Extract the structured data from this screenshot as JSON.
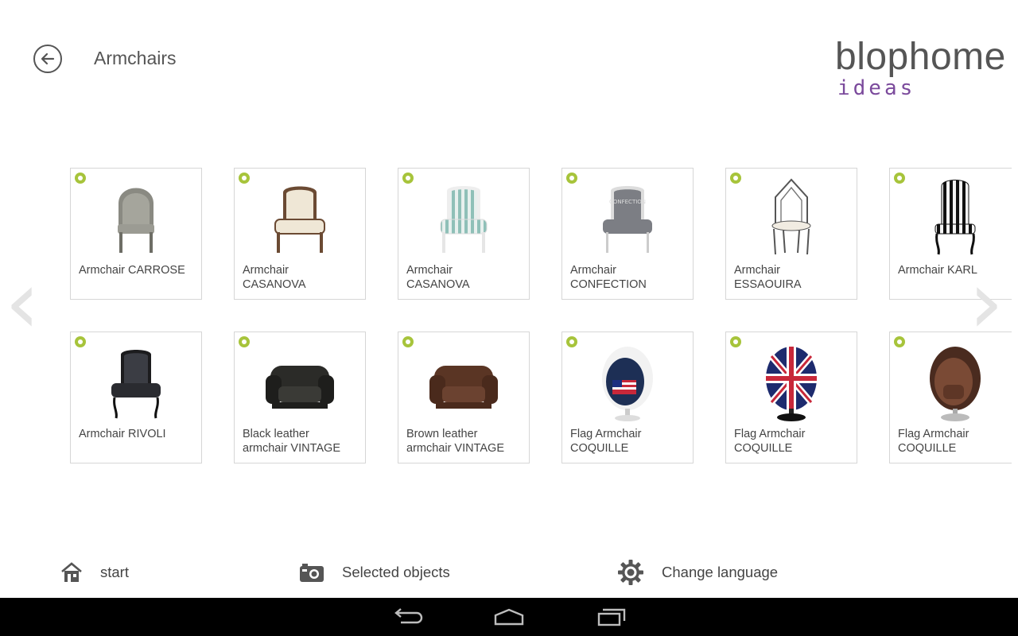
{
  "header": {
    "back_label": "Back",
    "title": "Armchairs"
  },
  "logo": {
    "main": "blophome",
    "sub": "ideas",
    "sub_color": "#7b4a9c"
  },
  "accent_color": "#a7c43b",
  "products": [
    {
      "name": "Armchair CARROSE",
      "kind": "canopy",
      "image": "grey hooded canopy armchair"
    },
    {
      "name": "Armchair\nCASANOVA",
      "kind": "bergere-cream",
      "image": "cream upholstered wooden bergere"
    },
    {
      "name": "Armchair\nCASANOVA",
      "kind": "striped",
      "image": "blue-green striped white armchair"
    },
    {
      "name": "Armchair\nCONFECTION",
      "kind": "grey-print",
      "image": "grey armchair with printed back"
    },
    {
      "name": "Armchair\nESSAOUIRA",
      "kind": "wire",
      "image": "wrought iron armchair with cushion"
    },
    {
      "name": "Armchair KARL",
      "kind": "stripe-highback",
      "image": "black and white striped high-back chair"
    },
    {
      "name": "Armchair RIVOLI",
      "kind": "black-bergere",
      "image": "black patchwork armchair"
    },
    {
      "name": "Black leather\narmchair VINTAGE",
      "kind": "chesterfield-black",
      "image": "black leather chesterfield armchair"
    },
    {
      "name": "Brown leather\narmchair VINTAGE",
      "kind": "chesterfield-brown",
      "image": "brown leather chesterfield armchair"
    },
    {
      "name": "Flag Armchair\nCOQUILLE",
      "kind": "egg-usa",
      "image": "egg chair with US flag cushion"
    },
    {
      "name": "Flag Armchair\nCOQUILLE",
      "kind": "egg-uk",
      "image": "egg chair with Union Jack"
    },
    {
      "name": "Flag Armchair\nCOQUILLE",
      "kind": "egg-brown",
      "image": "brown leather egg chair"
    }
  ],
  "bottom_bar": {
    "start_label": "start",
    "selected_label": "Selected objects",
    "language_label": "Change language"
  },
  "icons": {
    "back": "arrow-left-circle-icon",
    "start": "home-icon",
    "selected": "camera-icon",
    "language": "gear-icon",
    "prev": "chevron-left-icon",
    "next": "chevron-right-icon",
    "android_back": "android-back-icon",
    "android_home": "android-home-icon",
    "android_recent": "android-recent-icon"
  }
}
